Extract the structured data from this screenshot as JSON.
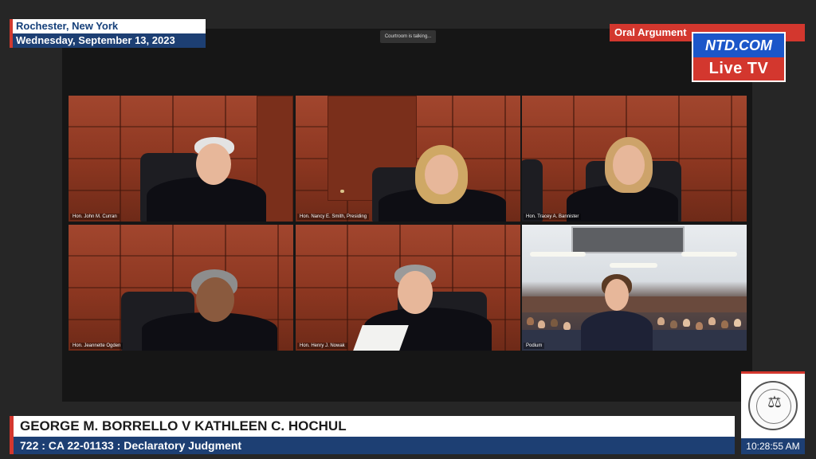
{
  "location": {
    "city": "Rochester, New York",
    "date": "Wednesday, September 13, 2023"
  },
  "status": {
    "talking": "Courtroom is talking..."
  },
  "segment": {
    "label": "Oral Argument"
  },
  "brand": {
    "top": "NTD.COM",
    "bottom": "Live TV",
    "blue": "#1b56c9",
    "red": "#d3372e"
  },
  "tiles": [
    {
      "name": "Hon. John M. Curran"
    },
    {
      "name": "Hon. Nancy E. Smith, Presiding"
    },
    {
      "name": "Hon. Tracey A. Bannister"
    },
    {
      "name": "Hon. Jeannette Ogden"
    },
    {
      "name": "Hon. Henry J. Nowak"
    },
    {
      "name": "Podium"
    }
  ],
  "case": {
    "title": "GEORGE M. BORRELLO V KATHLEEN C. HOCHUL",
    "subtitle": "722 : CA  22-01133 : Declaratory Judgment"
  },
  "clock": {
    "time": "10:28:55 AM"
  },
  "colors": {
    "navy": "#1d3f73",
    "accent_red": "#d3372e",
    "background": "#262626"
  }
}
